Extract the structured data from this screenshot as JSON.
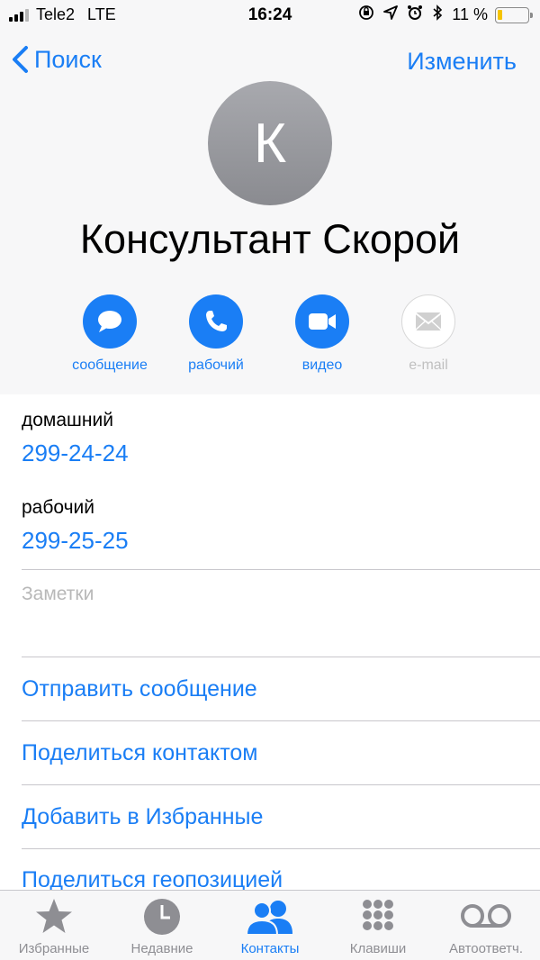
{
  "status_bar": {
    "carrier": "Tele2",
    "network": "LTE",
    "time": "16:24",
    "battery": "11 %"
  },
  "nav": {
    "back_label": "Поиск",
    "edit_label": "Изменить"
  },
  "contact": {
    "initial": "К",
    "name": "Консультант Скорой"
  },
  "actions": [
    {
      "label": "сообщение",
      "icon": "message-icon",
      "enabled": true
    },
    {
      "label": "рабочий",
      "icon": "phone-icon",
      "enabled": true
    },
    {
      "label": "видео",
      "icon": "video-icon",
      "enabled": true
    },
    {
      "label": "e-mail",
      "icon": "mail-icon",
      "enabled": false
    }
  ],
  "phones": [
    {
      "label": "домашний",
      "number": "299-24-24"
    },
    {
      "label": "рабочий",
      "number": "299-25-25"
    }
  ],
  "notes_placeholder": "Заметки",
  "links": [
    "Отправить сообщение",
    "Поделиться контактом",
    "Добавить в Избранные",
    "Поделиться геопозицией"
  ],
  "tabs": [
    {
      "label": "Избранные",
      "icon": "star-icon",
      "active": false
    },
    {
      "label": "Недавние",
      "icon": "clock-icon",
      "active": false
    },
    {
      "label": "Контакты",
      "icon": "contacts-icon",
      "active": true
    },
    {
      "label": "Клавиши",
      "icon": "keypad-icon",
      "active": false
    },
    {
      "label": "Автоответч.",
      "icon": "voicemail-icon",
      "active": false
    }
  ],
  "colors": {
    "accent": "#1a7ef5",
    "header_bg": "#f7f7f8",
    "inactive": "#8e8e93"
  }
}
